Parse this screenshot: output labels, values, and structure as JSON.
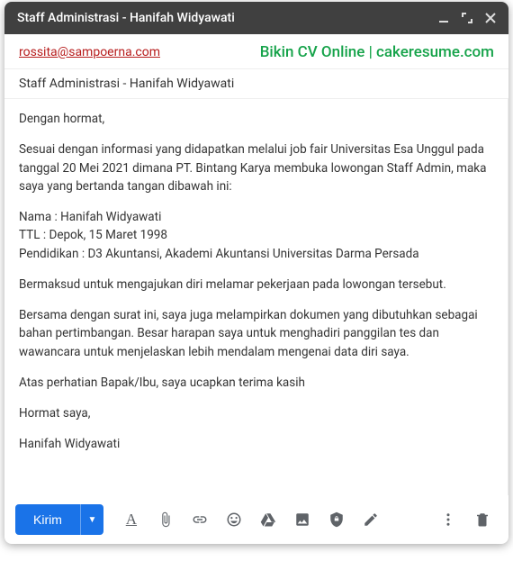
{
  "window": {
    "title": "Staff Administrasi - Hanifah Widyawati"
  },
  "recipient": {
    "email": "rossita@sampoerna.com"
  },
  "overlay": {
    "text": "Bikin CV Online | cakeresume.com"
  },
  "subject": {
    "text": "Staff Administrasi - Hanifah Widyawati"
  },
  "body": {
    "p1": "Dengan hormat,",
    "p2": "Sesuai dengan informasi yang didapatkan melalui job fair Universitas Esa Unggul pada tanggal 20 Mei 2021 dimana PT. Bintang Karya membuka lowongan Staff Admin, maka saya yang bertanda tangan dibawah ini:",
    "p3": "Nama : Hanifah Widyawati\nTTL : Depok, 15 Maret 1998\nPendidikan : D3 Akuntansi, Akademi Akuntansi Universitas Darma Persada",
    "p4": "Bermaksud untuk mengajukan diri melamar pekerjaan pada lowongan tersebut.",
    "p5": "Bersama dengan surat ini, saya juga melampirkan dokumen yang dibutuhkan sebagai bahan pertimbangan. Besar harapan saya untuk menghadiri panggilan tes dan wawancara untuk menjelaskan lebih mendalam mengenai data diri saya.",
    "p6": "Atas perhatian Bapak/Ibu, saya ucapkan terima kasih",
    "p7": "Hormat saya,",
    "p8": "Hanifah Widyawati"
  },
  "toolbar": {
    "send_label": "Kirim"
  }
}
